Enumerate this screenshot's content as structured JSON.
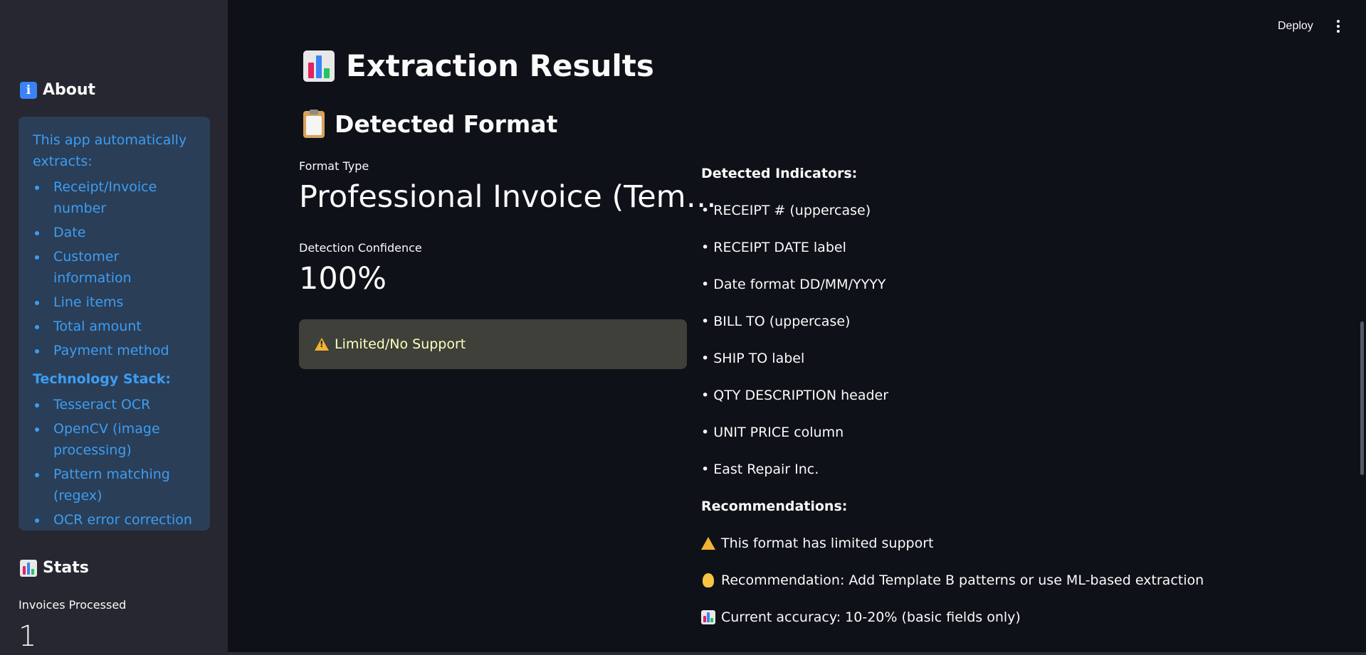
{
  "sidebar": {
    "about_heading": "About",
    "about_text": "This app automatically extracts:",
    "extract_items": [
      "Receipt/Invoice number",
      "Date",
      "Customer information",
      "Line items",
      "Total amount",
      "Payment method"
    ],
    "tech_heading": "Technology Stack:",
    "tech_items": [
      "Tesseract OCR",
      "OpenCV (image processing)",
      "Pattern matching (regex)",
      "OCR error correction"
    ],
    "stats_heading": "Stats",
    "invoices_label": "Invoices Processed",
    "invoices_value": "1"
  },
  "header": {
    "deploy_label": "Deploy"
  },
  "main": {
    "title": "Extraction Results",
    "subtitle": "Detected Format",
    "format_type_label": "Format Type",
    "format_type_value": "Professional Invoice (Tem…",
    "confidence_label": "Detection Confidence",
    "confidence_value": "100%",
    "support_warning": "Limited/No Support",
    "indicators_heading": "Detected Indicators:",
    "indicators": [
      "• RECEIPT # (uppercase)",
      "• RECEIPT DATE label",
      "• Date format DD/MM/YYYY",
      "• BILL TO (uppercase)",
      "• SHIP TO label",
      "• QTY DESCRIPTION header",
      "• UNIT PRICE column",
      "• East Repair Inc."
    ],
    "recommendations_heading": "Recommendations:",
    "recommendations": [
      {
        "icon": "warning-icon",
        "text": "This format has limited support"
      },
      {
        "icon": "lightbulb-icon",
        "text": "Recommendation: Add Template B patterns or use ML-based extraction"
      },
      {
        "icon": "bar-chart-icon",
        "text": "Current accuracy: 10-20% (basic fields only)"
      }
    ]
  },
  "colors": {
    "background": "#0e1117",
    "sidebar": "#262730",
    "info_text": "#3d9df3",
    "warning_text": "#ffffc2"
  }
}
